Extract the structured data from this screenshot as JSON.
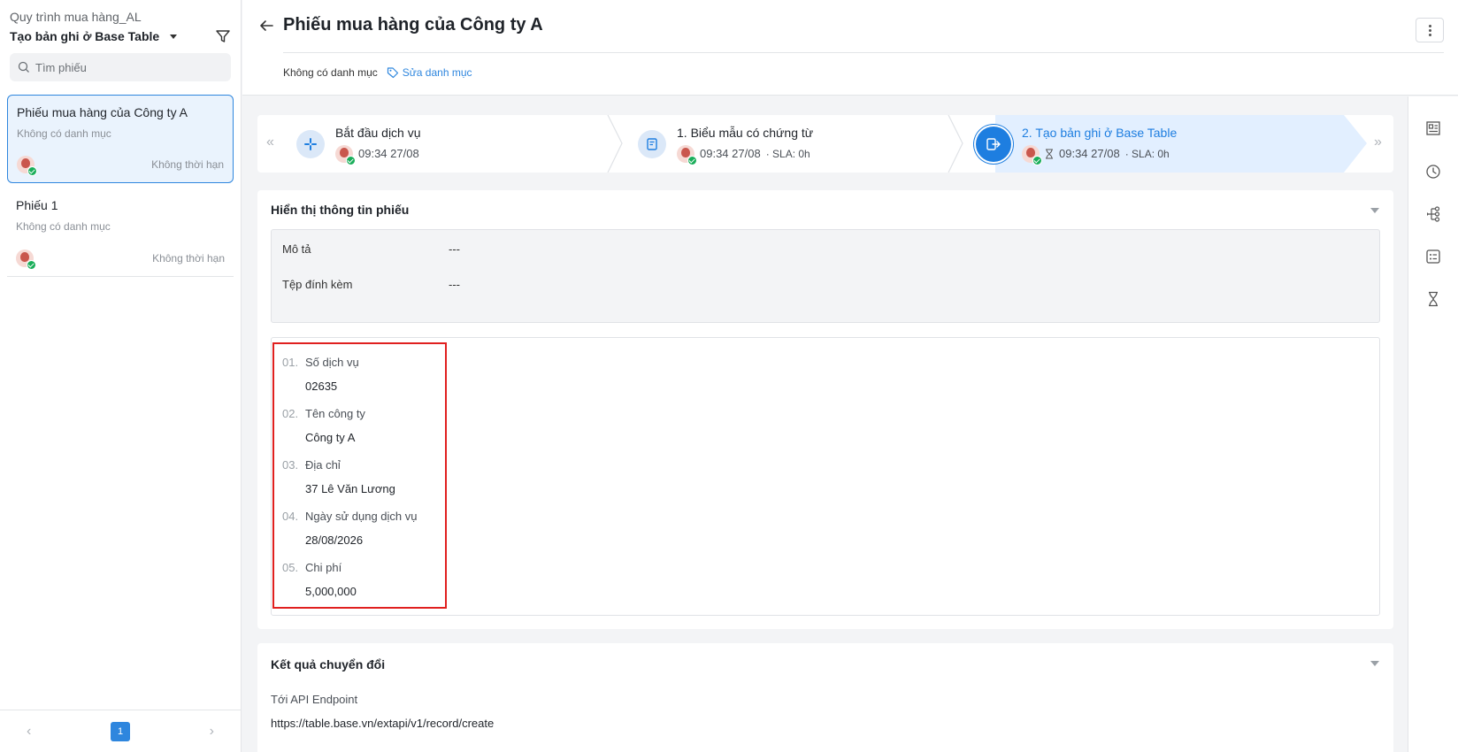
{
  "sidebar": {
    "process_name": "Quy trình mua hàng_AL",
    "stage_name": "Tạo bản ghi ở Base Table",
    "search_placeholder": "Tìm phiếu",
    "tickets": [
      {
        "title": "Phiếu mua hàng của Công ty A",
        "category": "Không có danh mục",
        "deadline": "Không thời hạn",
        "active": true
      },
      {
        "title": "Phiếu 1",
        "category": "Không có danh mục",
        "deadline": "Không thời hạn",
        "active": false
      }
    ],
    "pager": {
      "current_page": "1"
    }
  },
  "header": {
    "title": "Phiếu mua hàng của Công ty A",
    "category": "Không có danh mục",
    "edit_category": "Sửa danh mục"
  },
  "stepper": {
    "steps": [
      {
        "name": "Bắt đầu dịch vụ",
        "time": "09:34 27/08",
        "sla": ""
      },
      {
        "name": "1. Biểu mẫu có chứng từ",
        "time": "09:34 27/08",
        "sla": "· SLA: 0h"
      },
      {
        "name": "2. Tạo bản ghi ở Base Table",
        "time": "09:34 27/08",
        "sla": "· SLA: 0h"
      }
    ]
  },
  "ticket_info": {
    "title": "Hiển thị thông tin phiếu",
    "description_label": "Mô tả",
    "description_value": "---",
    "attachment_label": "Tệp đính kèm",
    "attachment_value": "---",
    "fields": [
      {
        "num": "01.",
        "label": "Số dịch vụ",
        "value": "02635"
      },
      {
        "num": "02.",
        "label": "Tên công ty",
        "value": "Công ty A"
      },
      {
        "num": "03.",
        "label": "Địa chỉ",
        "value": "37 Lê Văn Lương"
      },
      {
        "num": "04.",
        "label": "Ngày sử dụng dịch vụ",
        "value": "28/08/2026"
      },
      {
        "num": "05.",
        "label": "Chi phí",
        "value": "5,000,000"
      }
    ]
  },
  "conversion": {
    "title": "Kết quả chuyển đổi",
    "api_label": "Tới API Endpoint",
    "api_value": "https://table.base.vn/extapi/v1/record/create"
  },
  "colors": {
    "accent": "#1e7ee0",
    "highlight_border": "#e0201f",
    "success": "#1aae5a"
  }
}
